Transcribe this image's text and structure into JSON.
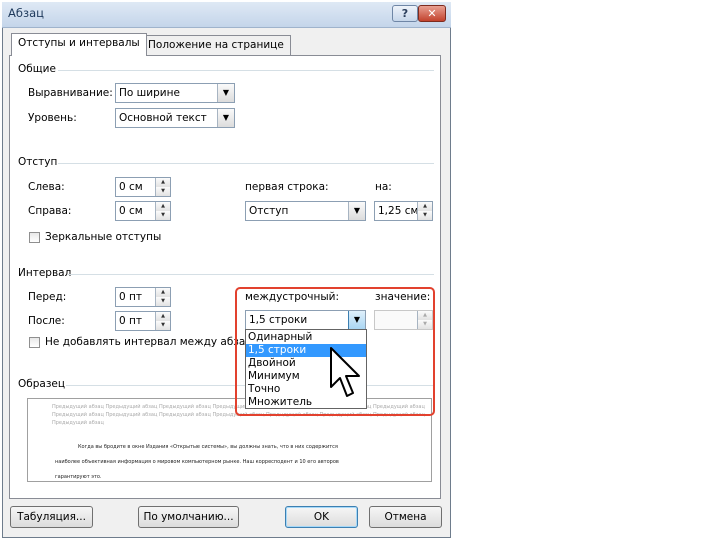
{
  "window": {
    "title": "Абзац",
    "help_label": "?",
    "close_label": "✕"
  },
  "tabs": [
    {
      "label": "Отступы и интервалы"
    },
    {
      "label": "Положение на странице"
    }
  ],
  "general": {
    "heading": "Общие",
    "alignment_label": "Выравнивание:",
    "alignment_value": "По ширине",
    "level_label": "Уровень:",
    "level_value": "Основной текст"
  },
  "indent": {
    "heading": "Отступ",
    "left_label": "Слева:",
    "left_value": "0 см",
    "right_label": "Справа:",
    "right_value": "0 см",
    "first_line_label": "первая строка:",
    "first_line_value": "Отступ",
    "by_label": "на:",
    "by_value": "1,25 см",
    "mirror_label": "Зеркальные отступы"
  },
  "spacing": {
    "heading": "Интервал",
    "before_label": "Перед:",
    "before_value": "0 пт",
    "after_label": "После:",
    "after_value": "0 пт",
    "line_spacing_label": "междустрочный:",
    "line_spacing_value": "1,5 строки",
    "value_label": "значение:",
    "value_value": "",
    "no_space_label": "Не добавлять интервал между абзацами",
    "options": [
      "Одинарный",
      "1,5 строки",
      "Двойной",
      "Минимум",
      "Точно",
      "Множитель"
    ],
    "selected_index": 1
  },
  "preview": {
    "heading": "Образец",
    "prev_para_1": "Предыдущий абзац Предыдущий абзац Предыдущий абзац Предыдущий абзац Предыдущий абзац Предыдущий абзац Предыдущий абзац",
    "prev_para_2": "Предыдущий абзац Предыдущий абзац Предыдущий абзац Предыдущий абзац Предыдущий абзац Предыдущий абзац Предыдущий абзац",
    "prev_para_3": "Предыдущий абзац",
    "main_line_1": "Когда вы бродите в окне Издания «Открытые системы», вы должны знать, что в них содержится",
    "main_line_2": "наиболее объективная информация о мировом компьютерном рынке. Наш корресподент и 10 его авторов",
    "main_line_3": "гарантируют это."
  },
  "buttons": {
    "tabs_label": "Табуляция...",
    "default_label": "По умолчанию...",
    "ok_label": "OK",
    "cancel_label": "Отмена"
  },
  "colors": {
    "highlight": "#e2412e",
    "selection": "#3399ff"
  }
}
